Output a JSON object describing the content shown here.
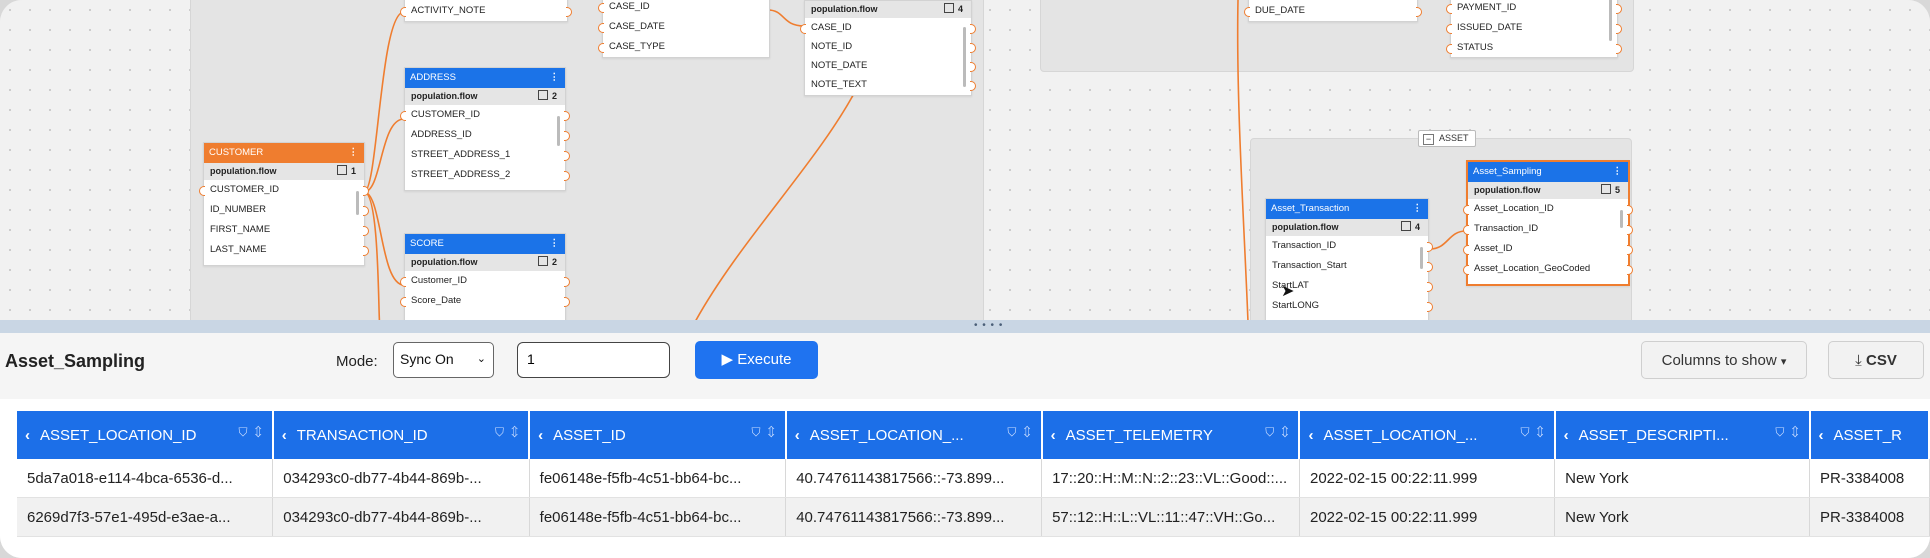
{
  "canvas": {
    "asset_group_label": "ASSET",
    "nodes": {
      "activity": {
        "fields": [
          "ACTIVITY_NOTE"
        ]
      },
      "case": {
        "fields": [
          "CASE_ID",
          "CASE_DATE",
          "CASE_TYPE"
        ]
      },
      "note": {
        "subheader": "population.flow",
        "count": "4",
        "fields": [
          "CASE_ID",
          "NOTE_ID",
          "NOTE_DATE",
          "NOTE_TEXT"
        ]
      },
      "due": {
        "fields": [
          "DUE_DATE"
        ]
      },
      "payment": {
        "fields": [
          "PAYMENT_ID",
          "ISSUED_DATE",
          "STATUS"
        ]
      },
      "address": {
        "title": "ADDRESS",
        "subheader": "population.flow",
        "count": "2",
        "fields": [
          "CUSTOMER_ID",
          "ADDRESS_ID",
          "STREET_ADDRESS_1",
          "STREET_ADDRESS_2"
        ]
      },
      "customer": {
        "title": "CUSTOMER",
        "subheader": "population.flow",
        "count": "1",
        "fields": [
          "CUSTOMER_ID",
          "ID_NUMBER",
          "FIRST_NAME",
          "LAST_NAME"
        ]
      },
      "score": {
        "title": "SCORE",
        "subheader": "population.flow",
        "count": "2",
        "fields": [
          "Customer_ID",
          "Score_Date"
        ]
      },
      "asset_transaction": {
        "title": "Asset_Transaction",
        "subheader": "population.flow",
        "count": "4",
        "fields": [
          "Transaction_ID",
          "Transaction_Start",
          "StartLAT",
          "StartLONG"
        ]
      },
      "asset_sampling": {
        "title": "Asset_Sampling",
        "subheader": "population.flow",
        "count": "5",
        "fields": [
          "Asset_Location_ID",
          "Transaction_ID",
          "Asset_ID",
          "Asset_Location_GeoCoded"
        ]
      }
    }
  },
  "panel": {
    "title": "Asset_Sampling",
    "mode_label": "Mode:",
    "mode_value": "Sync On",
    "step_value": "1",
    "execute_label": "Execute",
    "columns_label": "Columns to show",
    "csv_label": "CSV"
  },
  "table": {
    "columns": [
      "ASSET_LOCATION_ID",
      "TRANSACTION_ID",
      "ASSET_ID",
      "ASSET_LOCATION_...",
      "ASSET_TELEMETRY",
      "ASSET_LOCATION_...",
      "ASSET_DESCRIPTI...",
      "ASSET_R"
    ],
    "rows": [
      [
        "5da7a018-e114-4bca-6536-d...",
        "034293c0-db77-4b44-869b-...",
        "fe06148e-f5fb-4c51-bb64-bc...",
        "40.74761143817566::-73.899...",
        "17::20::H::M::N::2::23::VL::Good::...",
        "2022-02-15 00:22:11.999",
        "New York",
        "PR-3384008"
      ],
      [
        "6269d7f3-57e1-495d-e3ae-a...",
        "034293c0-db77-4b44-869b-...",
        "fe06148e-f5fb-4c51-bb64-bc...",
        "40.74761143817566::-73.899...",
        "57::12::H::L::VL::11::47::VH::Go...",
        "2022-02-15 00:22:11.999",
        "New York",
        "PR-3384008"
      ]
    ]
  },
  "colors": {
    "accent_blue": "#1c6fe8",
    "accent_orange": "#ef7d2f"
  }
}
